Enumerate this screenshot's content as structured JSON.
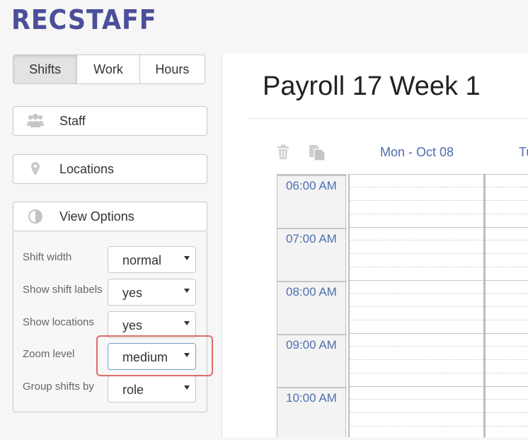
{
  "app": {
    "logo": "RECSTAFF"
  },
  "tabs": [
    "Shifts",
    "Work",
    "Hours"
  ],
  "sidebar": {
    "staff": {
      "label": "Staff",
      "icon": "users-icon"
    },
    "locations": {
      "label": "Locations",
      "icon": "map-pin-icon"
    },
    "view_options": {
      "label": "View Options",
      "icon": "contrast-icon"
    }
  },
  "options": [
    {
      "label": "Shift width",
      "value": "normal"
    },
    {
      "label": "Show shift labels",
      "value": "yes"
    },
    {
      "label": "Show locations",
      "value": "yes"
    },
    {
      "label": "Zoom level",
      "value": "medium"
    },
    {
      "label": "Group shifts by",
      "value": "role"
    }
  ],
  "main": {
    "title": "Payroll 17 Week 1",
    "days": [
      "Mon - Oct 08",
      "Tu"
    ],
    "times": [
      "06:00 AM",
      "07:00 AM",
      "08:00 AM",
      "09:00 AM",
      "10:00 AM"
    ]
  },
  "colors": {
    "brand": "#4b4f9a",
    "link": "#4e6fb0",
    "highlight": "#e06a67"
  }
}
